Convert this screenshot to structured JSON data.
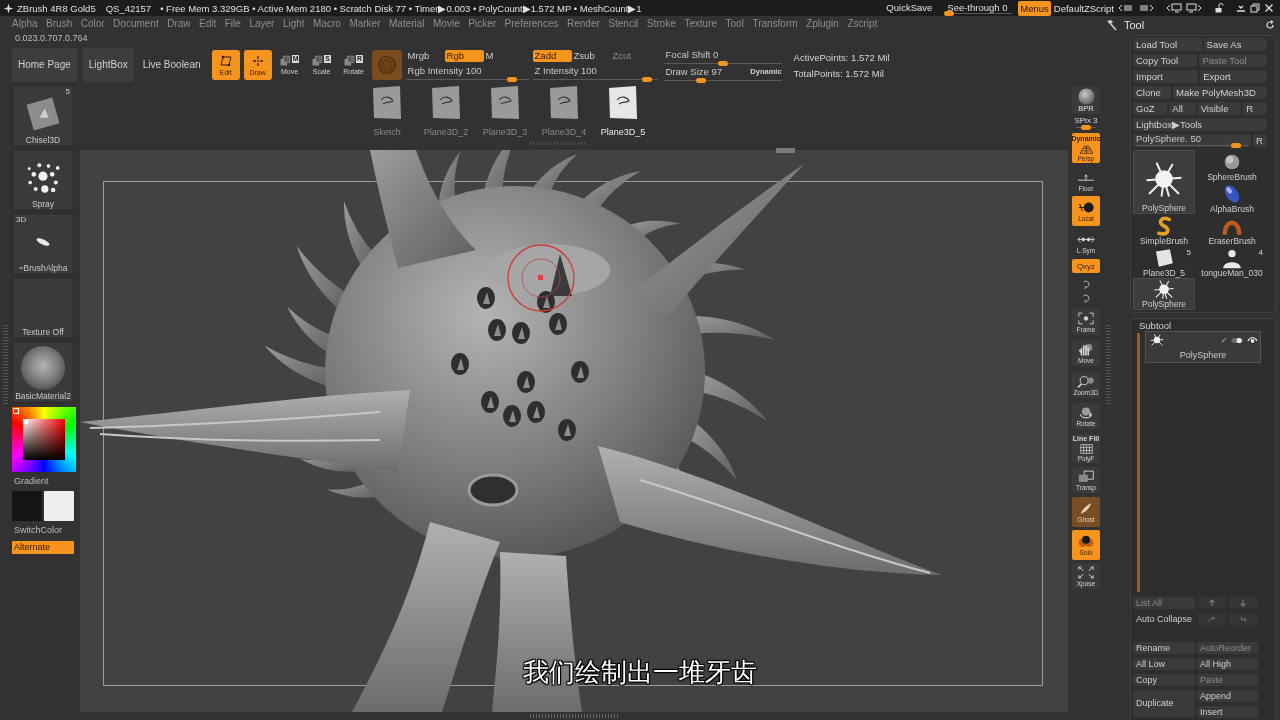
{
  "title_bar": {
    "app_name": "ZBrush 4R8 Gold5",
    "project": "QS_42157",
    "stats": "• Free Mem 3.329GB • Active Mem 2180 • Scratch Disk 77 • Timer▶0.003 • PolyCount▶1.572 MP • MeshCount▶1",
    "quicksave": "QuickSave",
    "see_through": {
      "label": "See-through 0",
      "level": 0
    },
    "menus": {
      "label": "Menus",
      "on": true
    },
    "script": "DefaultZScript"
  },
  "menu_bar": [
    "Alpha",
    "Brush",
    "Color",
    "Document",
    "Draw",
    "Edit",
    "File",
    "Layer",
    "Light",
    "Macro",
    "Marker",
    "Material",
    "Movie",
    "Picker",
    "Preferences",
    "Render",
    "Stencil",
    "Stroke",
    "Texture",
    "Tool",
    "Transform",
    "Zplugin",
    "Zscript"
  ],
  "color_readout": "0.023.0.707.0.764",
  "top_shelf": {
    "buttons": [
      {
        "label": "Home Page",
        "kind": "button"
      },
      {
        "label": "LightBox",
        "kind": "button"
      },
      {
        "label": "Live Boolean",
        "kind": "toggle"
      }
    ],
    "modes": [
      {
        "label": "Edit",
        "kind": "edit",
        "on": true
      },
      {
        "label": "Draw",
        "kind": "draw",
        "on": true
      },
      {
        "label": "Move",
        "kind": "move",
        "key": "M",
        "on": false
      },
      {
        "label": "Scale",
        "kind": "scale",
        "key": "S",
        "on": false
      },
      {
        "label": "Rotate",
        "kind": "rotate",
        "key": "R",
        "on": false
      }
    ],
    "color_modes": [
      {
        "label": "Mrgb",
        "selected": false
      },
      {
        "label": "Rgb",
        "selected": true
      },
      {
        "label": "M",
        "selected": false
      }
    ],
    "rgb_intensity": {
      "label": "Rgb Intensity 100",
      "level": 0.9
    },
    "z_modes": [
      {
        "label": "Zadd",
        "selected": true,
        "disabled": false
      },
      {
        "label": "Zsub",
        "selected": false,
        "disabled": false
      },
      {
        "label": "Zcut",
        "selected": false,
        "disabled": true
      }
    ],
    "z_intensity": {
      "label": "Z Intensity 100",
      "level": 0.95
    },
    "focal_shift": {
      "label": "Focal Shift 0",
      "level": 0.5
    },
    "draw_size": {
      "label": "Draw Size 97",
      "level": 0.3,
      "note": "Dynamic"
    },
    "points": [
      "ActivePoints: 1.572 Mil",
      "TotalPoints: 1.572 Mil"
    ]
  },
  "recent_tools": [
    {
      "label": "Sketch",
      "selected": false
    },
    {
      "label": "Plane3D_2",
      "selected": false
    },
    {
      "label": "Plane3D_3",
      "selected": false
    },
    {
      "label": "Plane3D_4",
      "selected": false
    },
    {
      "label": "Plane3D_5",
      "selected": true
    }
  ],
  "left_shelf": {
    "brush": {
      "label": "Chisel3D",
      "badge": "5"
    },
    "stroke": {
      "label": "Spray"
    },
    "alpha": {
      "label": "~BrushAlpha",
      "badge": "3D"
    },
    "texture": {
      "label": "Texture Off"
    },
    "material": {
      "label": "BasicMaterial2"
    },
    "gradient": "Gradient",
    "swatches": [
      {
        "color": "#141414"
      },
      {
        "color": "#eeeeee"
      }
    ],
    "switch_color": "SwitchColor",
    "alternate": {
      "label": "Alternate",
      "on": true
    }
  },
  "right_shelf": {
    "bpr": "BPR",
    "spix": {
      "label": "SPix 3",
      "level": 0.5
    },
    "buttons": [
      {
        "kind": "persp",
        "label": "Persp",
        "note": "Dynamic",
        "on": true,
        "disabled": false
      },
      {
        "kind": "floor",
        "label": "Floor",
        "on": false,
        "disabled": false
      },
      {
        "kind": "local",
        "label": "Local",
        "on": true,
        "disabled": false
      },
      {
        "kind": "lsym",
        "label": "L.Sym",
        "on": false,
        "disabled": false
      },
      {
        "kind": "qxyz",
        "label": "Qxyz",
        "on": true,
        "disabled": false
      },
      {
        "kind": "rot_y",
        "on": false,
        "disabled": false
      },
      {
        "kind": "rot_z",
        "on": false,
        "disabled": false
      },
      {
        "kind": "frame",
        "label": "Frame",
        "on": false,
        "disabled": false
      },
      {
        "kind": "move",
        "label": "Move",
        "on": false,
        "disabled": false
      },
      {
        "kind": "zoom",
        "label": "Zoom3D",
        "on": false,
        "disabled": false
      },
      {
        "kind": "rotate",
        "label": "Rotate",
        "on": false,
        "disabled": false
      },
      {
        "kind": "polyf",
        "label": "PolyF",
        "note": "Line Fill",
        "on": false,
        "disabled": false
      },
      {
        "kind": "transp",
        "label": "Transp",
        "on": false,
        "disabled": false
      },
      {
        "kind": "ghost",
        "label": "Ghost",
        "on": true,
        "disabled": true
      },
      {
        "kind": "solo",
        "label": "Solo",
        "on": true,
        "disabled": false
      },
      {
        "kind": "xpose",
        "label": "Xpose",
        "on": false,
        "disabled": false
      }
    ]
  },
  "tool_panel": {
    "title": "Tool",
    "rows": [
      [
        {
          "label": "Load Tool",
          "disabled": false
        },
        {
          "label": "Save As",
          "disabled": false
        }
      ],
      [
        {
          "label": "Copy Tool",
          "disabled": false
        },
        {
          "label": "Paste Tool",
          "disabled": true
        }
      ],
      [
        {
          "label": "Import",
          "disabled": false
        },
        {
          "label": "Export",
          "disabled": false
        }
      ],
      [
        {
          "label": "Clone",
          "disabled": false
        },
        {
          "label": "Make PolyMesh3D",
          "disabled": false
        }
      ],
      [
        {
          "label": "GoZ",
          "disabled": false
        },
        {
          "label": "All",
          "disabled": false
        },
        {
          "label": "Visible",
          "disabled": false
        },
        {
          "label": "R",
          "disabled": false
        }
      ],
      [
        {
          "label": "Lightbox▶Tools",
          "disabled": false
        }
      ]
    ],
    "tool_slider": {
      "label": "PolySphere. 50",
      "level": 0.92,
      "reset": "R"
    },
    "current_tool": {
      "label": "PolySphere",
      "kind": "spiky"
    },
    "tools": [
      {
        "label": "SphereBrush",
        "kind": "sphere",
        "selected": false
      },
      {
        "label": "AlphaBrush",
        "kind": "blob",
        "selected": false
      },
      {
        "label": "SimpleBrush",
        "kind": "s_curve",
        "selected": false
      },
      {
        "label": "EraserBrush",
        "kind": "ring",
        "selected": false
      },
      {
        "label": "Plane3D_5",
        "kind": "plane",
        "badge": "5",
        "selected": false
      },
      {
        "label": "tongueMan_030",
        "kind": "figure",
        "badge": "4",
        "selected": false
      },
      {
        "label": "PolySphere",
        "kind": "spiky",
        "selected": true
      }
    ]
  },
  "subtool": {
    "title": "Subtool",
    "items": [
      {
        "label": "PolySphere",
        "selected": true,
        "visible": true
      }
    ],
    "list_all": {
      "label": "List All",
      "disabled": true
    },
    "auto_collapse": {
      "label": "Auto Collapse",
      "disabled": false
    },
    "buttons": [
      {
        "label": "Rename",
        "disabled": false
      },
      {
        "label": "AutoReorder",
        "disabled": true
      },
      {
        "label": "All Low",
        "disabled": false
      },
      {
        "label": "All High",
        "disabled": false
      },
      {
        "label": "Copy",
        "disabled": false
      },
      {
        "label": "Paste",
        "disabled": true
      }
    ],
    "duplicate": "Duplicate",
    "append": "Append",
    "insert": "Insert"
  },
  "viewport": {
    "subtitle": "我们绘制出一堆牙齿"
  }
}
